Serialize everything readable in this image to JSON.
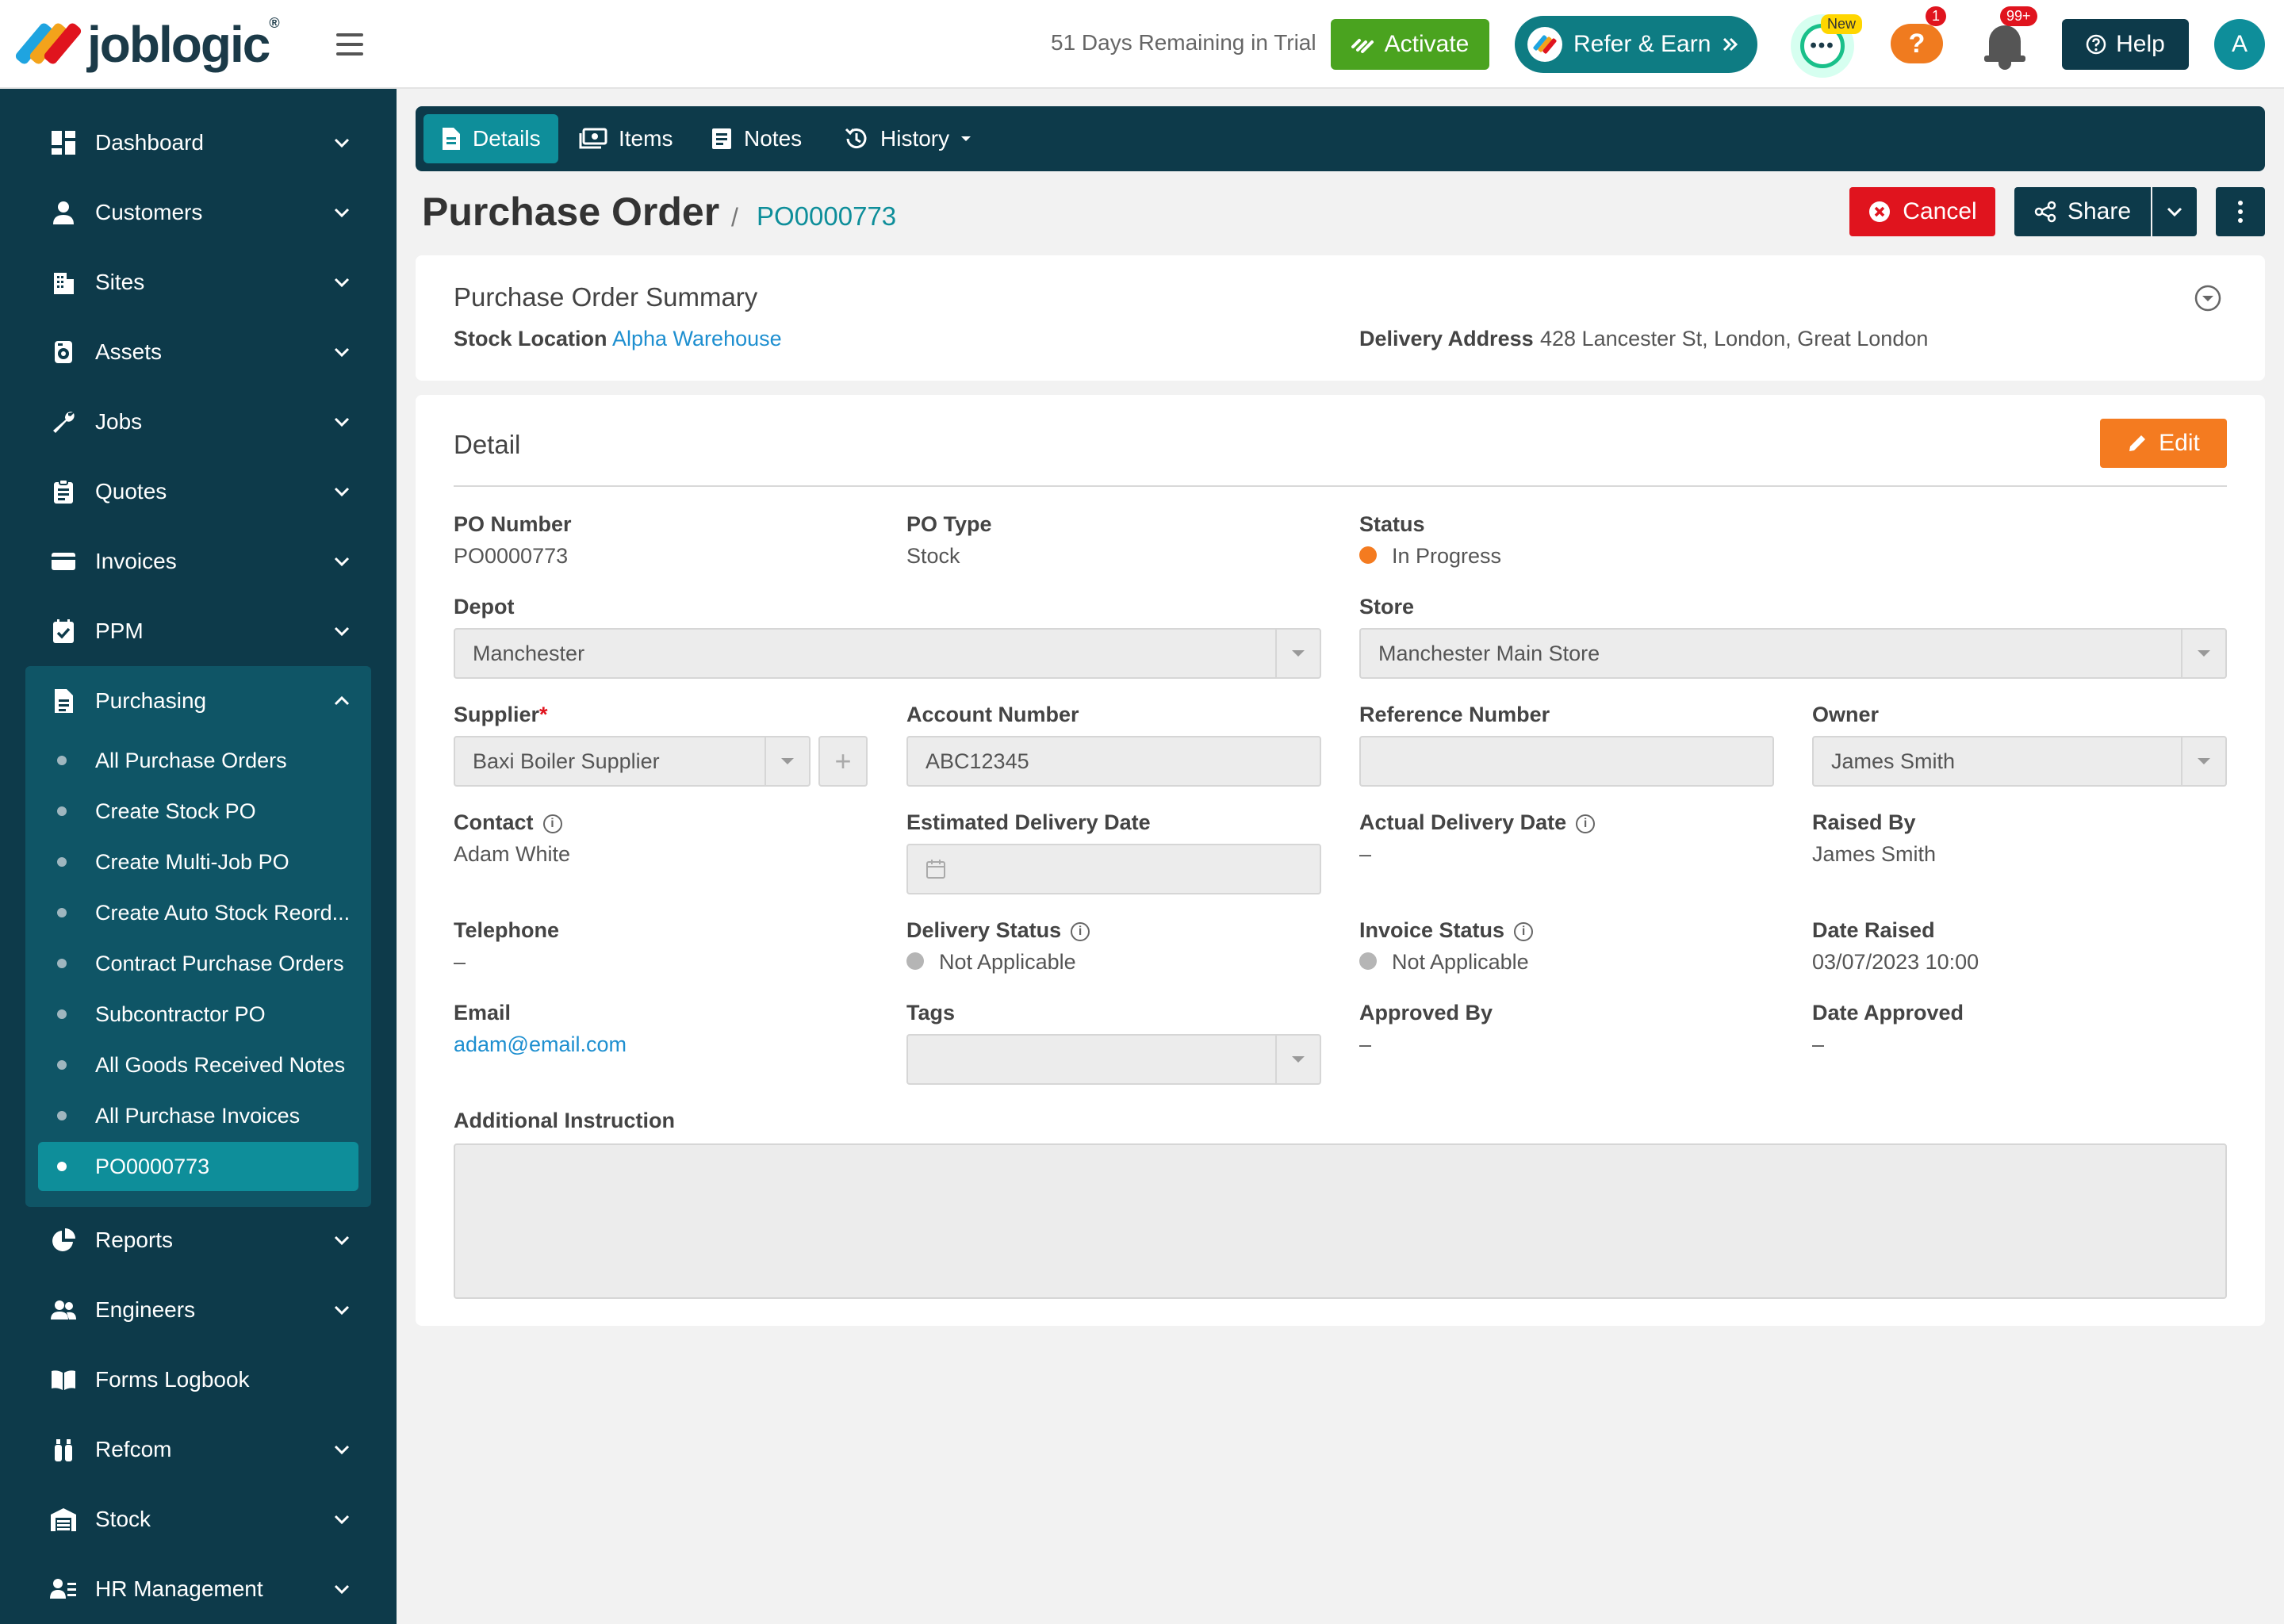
{
  "header": {
    "logo_text": "joblogic",
    "logo_reg": "®",
    "trial_text": "51 Days Remaining in Trial",
    "activate_label": "Activate",
    "refer_label": "Refer & Earn",
    "new_badge": "New",
    "help_badge": "1",
    "notif_badge": "99+",
    "help_label": "Help",
    "avatar_letter": "A"
  },
  "sidebar": {
    "items": [
      {
        "label": "Dashboard"
      },
      {
        "label": "Customers"
      },
      {
        "label": "Sites"
      },
      {
        "label": "Assets"
      },
      {
        "label": "Jobs"
      },
      {
        "label": "Quotes"
      },
      {
        "label": "Invoices"
      },
      {
        "label": "PPM"
      },
      {
        "label": "Purchasing"
      },
      {
        "label": "Reports"
      },
      {
        "label": "Engineers"
      },
      {
        "label": "Forms Logbook"
      },
      {
        "label": "Refcom"
      },
      {
        "label": "Stock"
      },
      {
        "label": "HR Management"
      }
    ],
    "purchasing_sub": [
      {
        "label": "All Purchase Orders"
      },
      {
        "label": "Create Stock PO"
      },
      {
        "label": "Create Multi-Job PO"
      },
      {
        "label": "Create Auto Stock Reord..."
      },
      {
        "label": "Contract Purchase Orders"
      },
      {
        "label": "Subcontractor PO"
      },
      {
        "label": "All Goods Received Notes"
      },
      {
        "label": "All Purchase Invoices"
      },
      {
        "label": "PO0000773"
      }
    ]
  },
  "tabs": [
    {
      "label": "Details"
    },
    {
      "label": "Items"
    },
    {
      "label": "Notes"
    },
    {
      "label": "History"
    }
  ],
  "page": {
    "title": "Purchase Order",
    "sep": "/",
    "po_id": "PO0000773",
    "cancel_label": "Cancel",
    "share_label": "Share"
  },
  "summary": {
    "title": "Purchase Order Summary",
    "stock_location_label": "Stock Location",
    "stock_location_value": "Alpha Warehouse",
    "delivery_address_label": "Delivery Address",
    "delivery_address_value": "428 Lancester St, London, Great London"
  },
  "detail": {
    "title": "Detail",
    "edit_label": "Edit",
    "po_number_label": "PO Number",
    "po_number_value": "PO0000773",
    "po_type_label": "PO Type",
    "po_type_value": "Stock",
    "status_label": "Status",
    "status_value": "In Progress",
    "depot_label": "Depot",
    "depot_value": "Manchester",
    "store_label": "Store",
    "store_value": "Manchester Main Store",
    "supplier_label": "Supplier",
    "supplier_required": "*",
    "supplier_value": "Baxi Boiler Supplier",
    "account_label": "Account Number",
    "account_value": "ABC12345",
    "reference_label": "Reference Number",
    "reference_value": "",
    "owner_label": "Owner",
    "owner_value": "James Smith",
    "contact_label": "Contact",
    "contact_value": "Adam White",
    "est_delivery_label": "Estimated Delivery Date",
    "actual_delivery_label": "Actual Delivery Date",
    "actual_delivery_value": "–",
    "raised_by_label": "Raised By",
    "raised_by_value": "James Smith",
    "telephone_label": "Telephone",
    "telephone_value": "–",
    "delivery_status_label": "Delivery Status",
    "delivery_status_value": "Not Applicable",
    "invoice_status_label": "Invoice Status",
    "invoice_status_value": "Not Applicable",
    "date_raised_label": "Date Raised",
    "date_raised_value": "03/07/2023 10:00",
    "email_label": "Email",
    "email_value": "adam@email.com",
    "tags_label": "Tags",
    "approved_by_label": "Approved By",
    "approved_by_value": "–",
    "date_approved_label": "Date Approved",
    "date_approved_value": "–",
    "additional_label": "Additional Instruction",
    "info_glyph": "i"
  },
  "colors": {
    "sidebar_bg": "#0d3a4a",
    "accent": "#0e8e9a",
    "status_in_progress": "#f47b20",
    "status_na": "#b5b5b5",
    "cancel": "#e0141e",
    "edit": "#f47b20",
    "activate": "#4aa31f"
  }
}
